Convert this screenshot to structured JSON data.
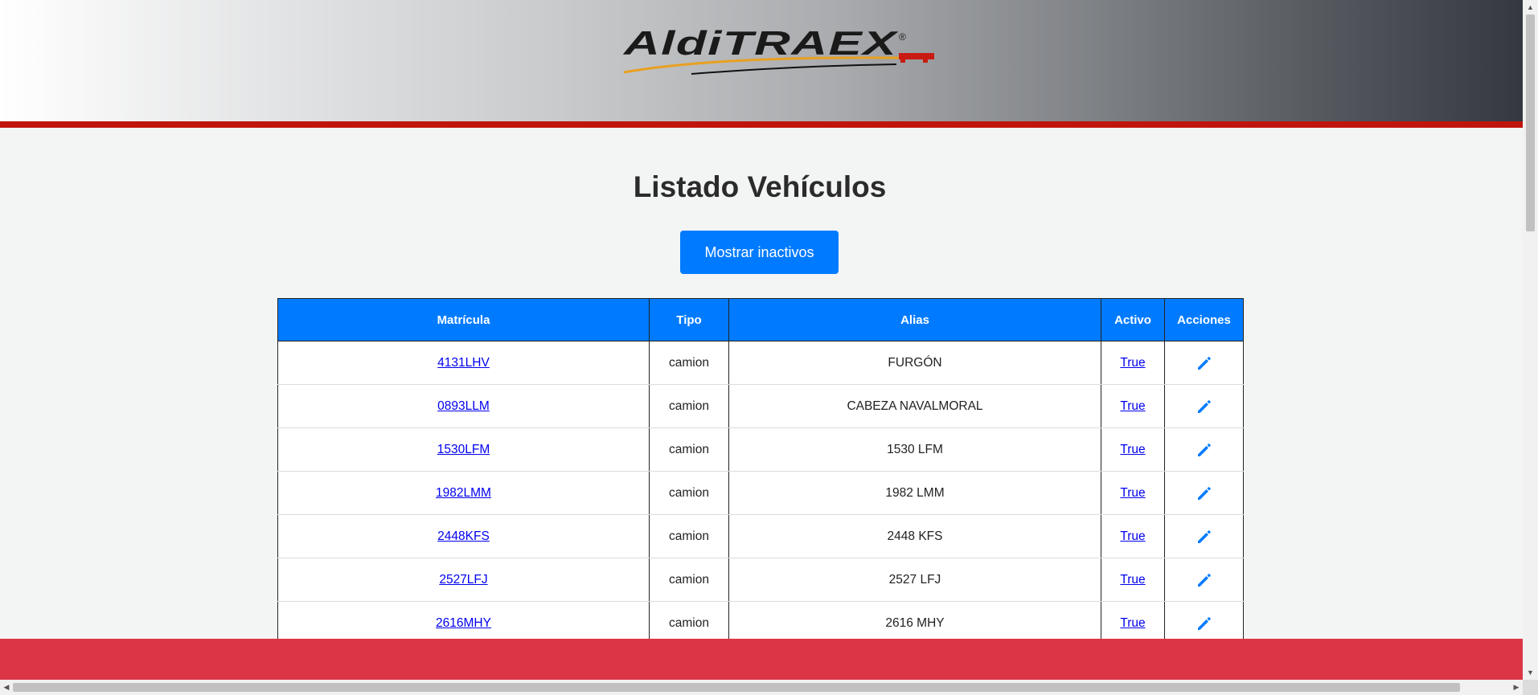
{
  "logo": {
    "text": "AldiTRAEX",
    "registered": "®"
  },
  "page": {
    "title": "Listado Vehículos"
  },
  "actions": {
    "show_inactive_label": "Mostrar inactivos"
  },
  "table": {
    "headers": [
      "Matrícula",
      "Tipo",
      "Alias",
      "Activo",
      "Acciones"
    ],
    "rows": [
      {
        "matricula": "4131LHV",
        "tipo": "camion",
        "alias": "FURGÓN",
        "activo": "True"
      },
      {
        "matricula": "0893LLM",
        "tipo": "camion",
        "alias": "CABEZA NAVALMORAL",
        "activo": "True"
      },
      {
        "matricula": "1530LFM",
        "tipo": "camion",
        "alias": "1530 LFM",
        "activo": "True"
      },
      {
        "matricula": "1982LMM",
        "tipo": "camion",
        "alias": "1982 LMM",
        "activo": "True"
      },
      {
        "matricula": "2448KFS",
        "tipo": "camion",
        "alias": "2448 KFS",
        "activo": "True"
      },
      {
        "matricula": "2527LFJ",
        "tipo": "camion",
        "alias": "2527 LFJ",
        "activo": "True"
      },
      {
        "matricula": "2616MHY",
        "tipo": "camion",
        "alias": "2616 MHY",
        "activo": "True"
      }
    ]
  },
  "icons": {
    "edit": "pencil-icon"
  },
  "colors": {
    "primary": "#007bff",
    "header_bar": "#c0150c",
    "footer": "#dc3545"
  }
}
